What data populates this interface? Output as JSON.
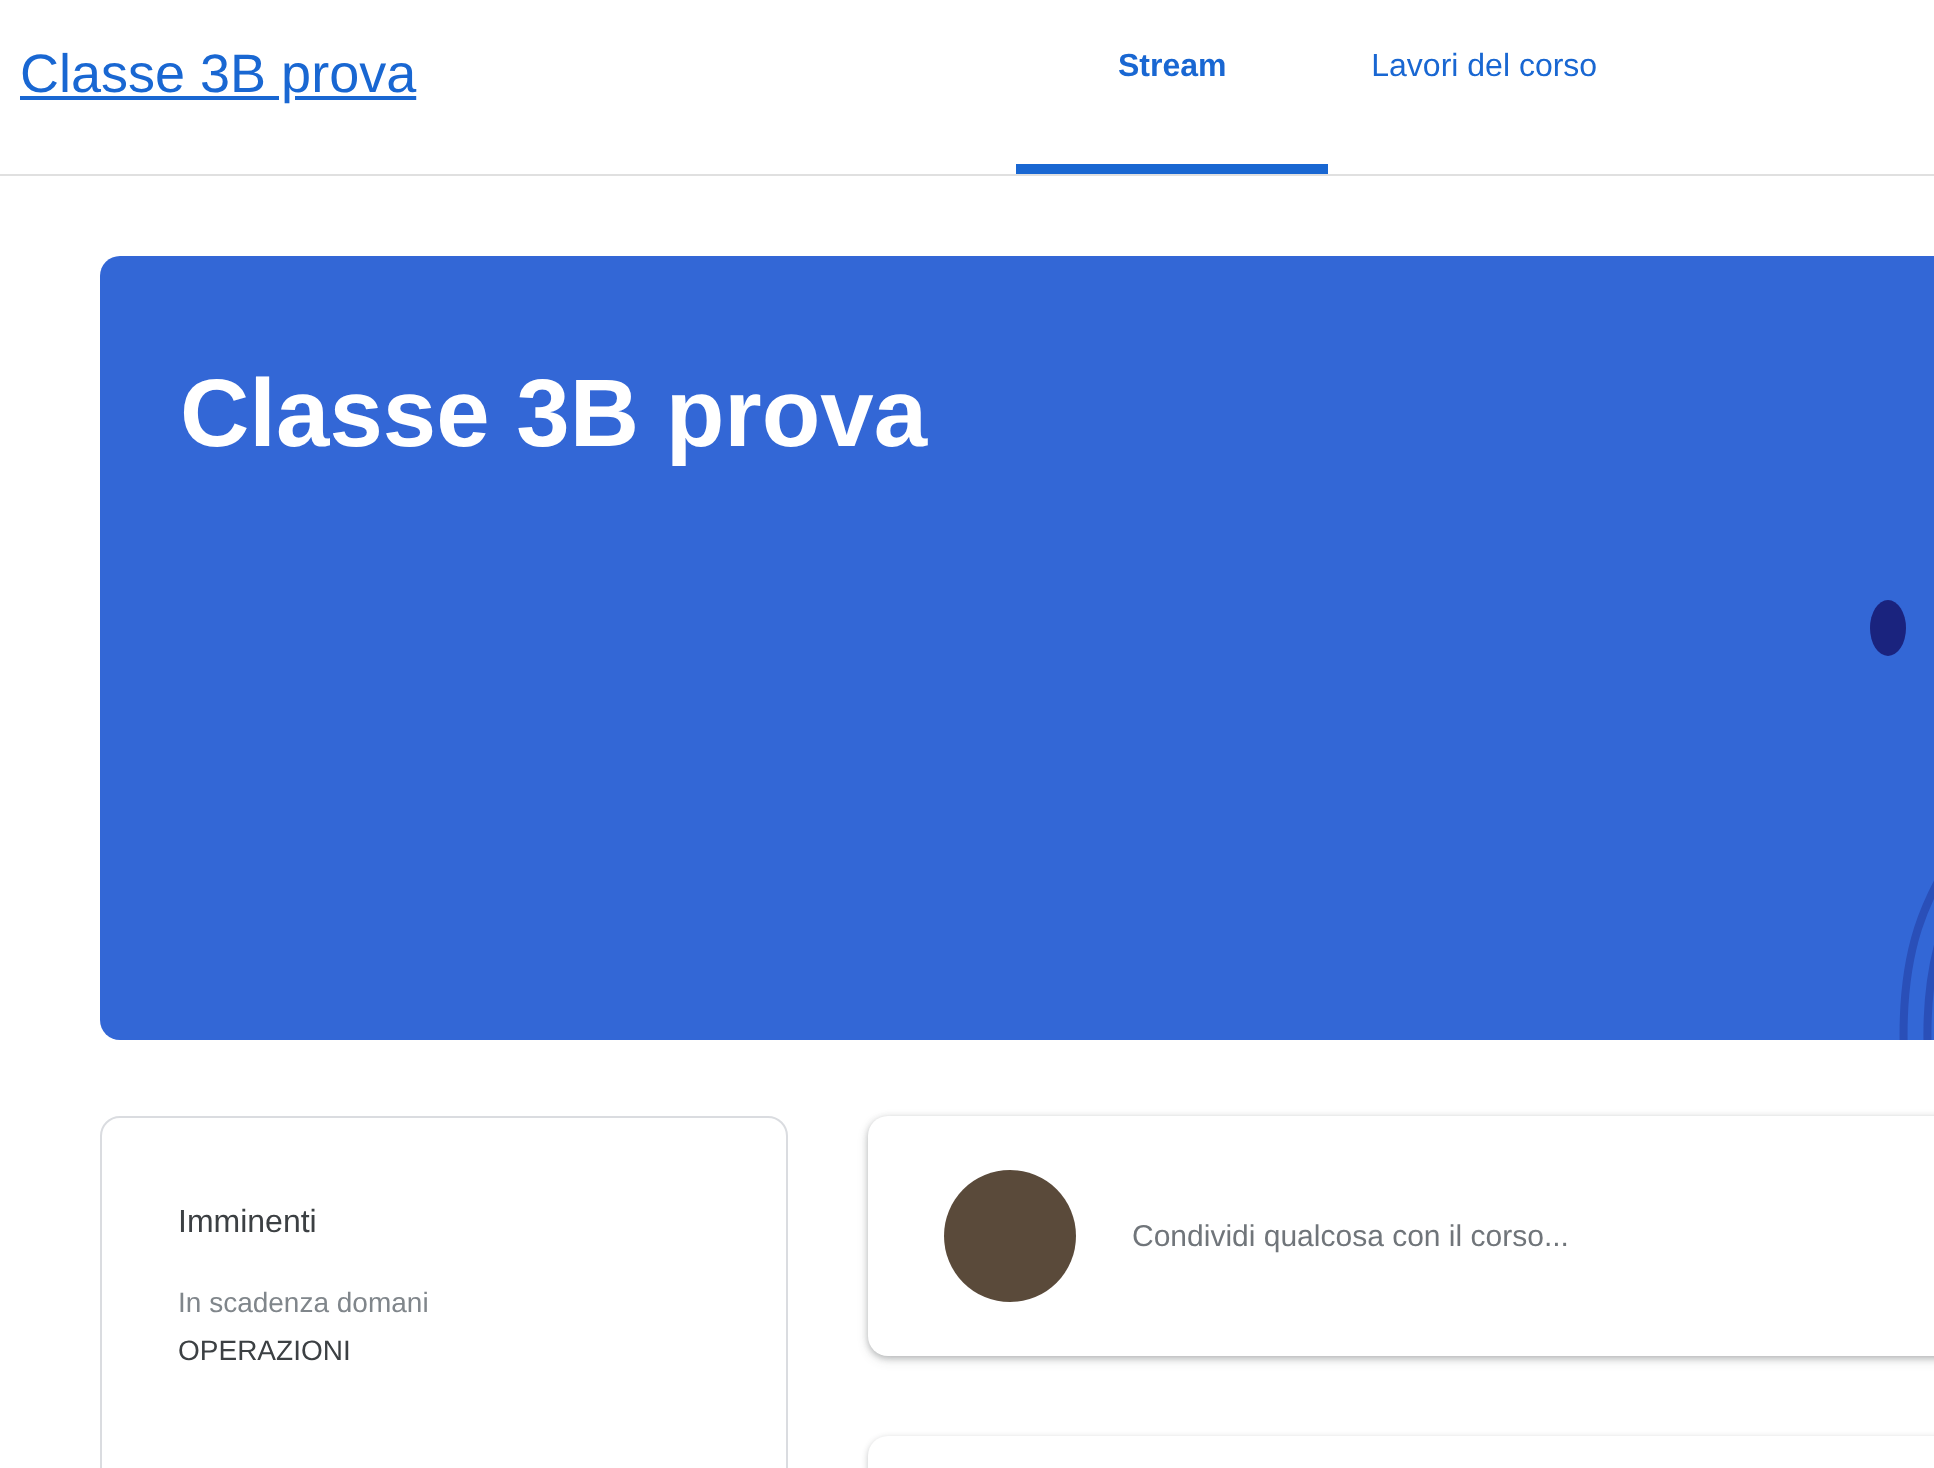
{
  "header": {
    "class_link": "Classe 3B prova"
  },
  "tabs": [
    {
      "label": "Stream",
      "selected": true
    },
    {
      "label": "Lavori del corso",
      "selected": false
    }
  ],
  "banner": {
    "title": "Classe 3B prova"
  },
  "upcoming": {
    "title": "Imminenti",
    "due_label": "In scadenza domani",
    "assignment": "OPERAZIONI"
  },
  "share": {
    "placeholder": "Condividi qualcosa con il corso..."
  }
}
